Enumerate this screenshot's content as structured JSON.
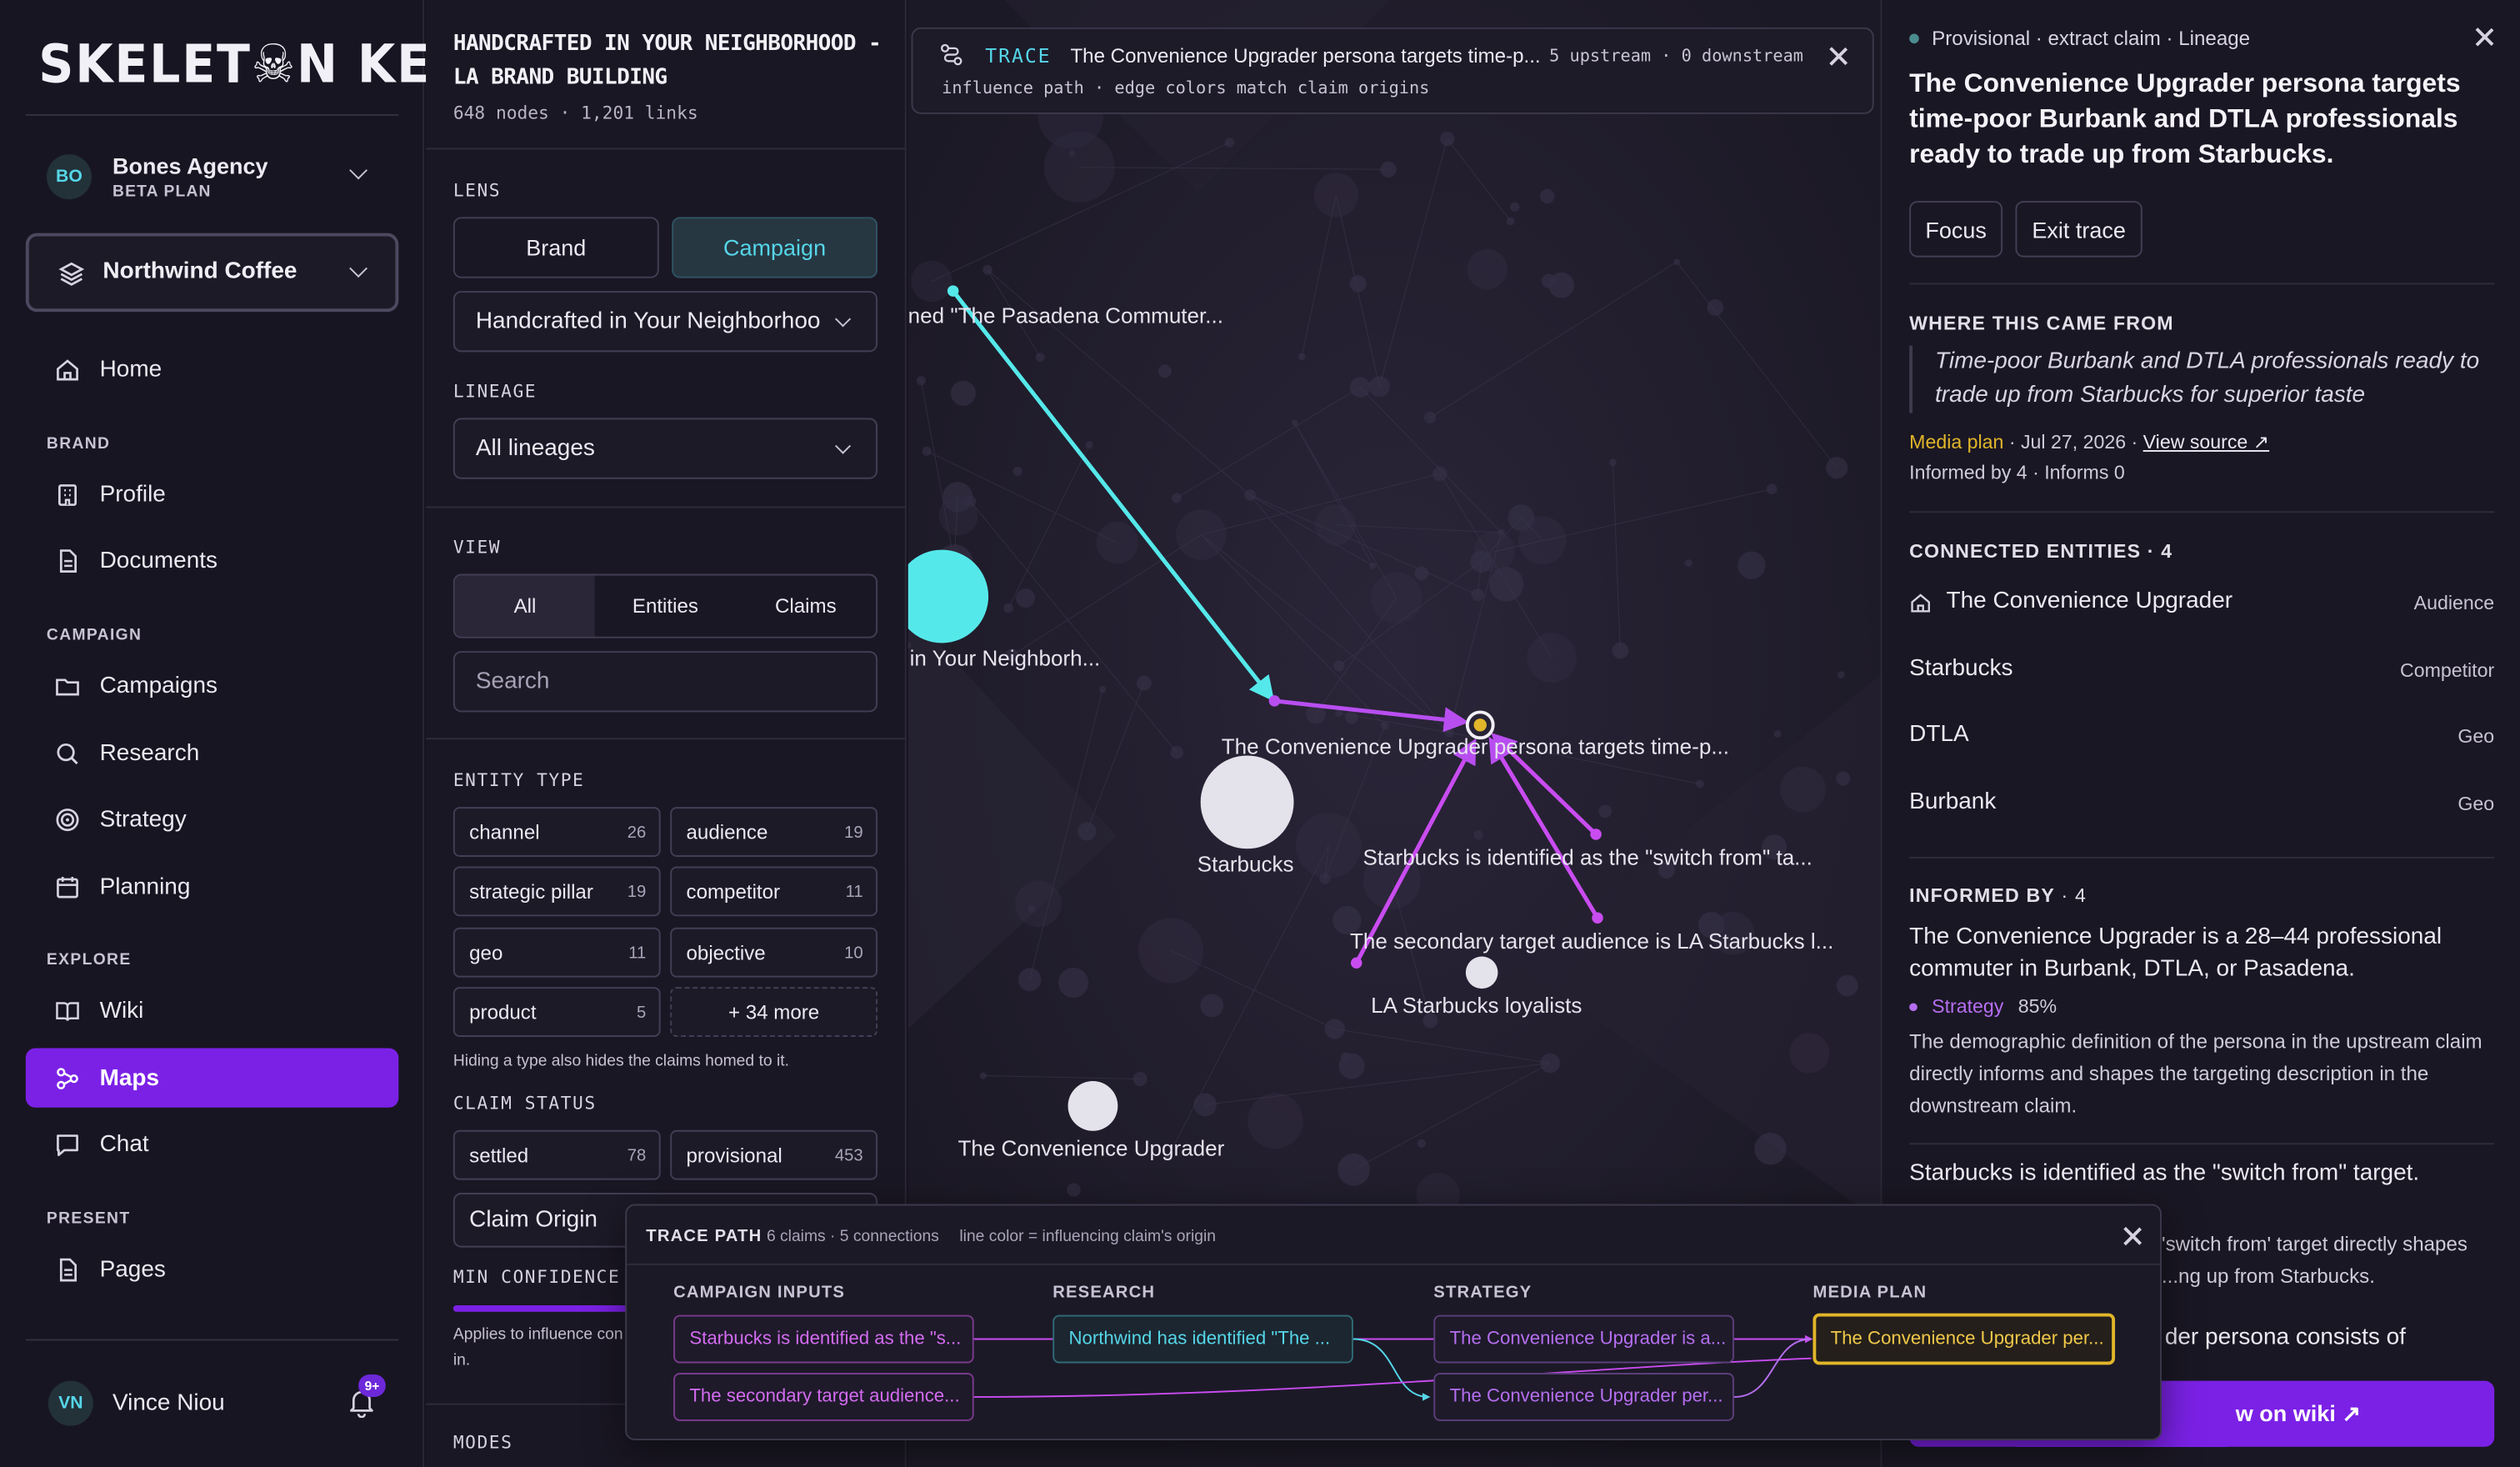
{
  "sidebar": {
    "logo": "SKELET☠N KEY",
    "agency": {
      "initials": "BO",
      "name": "Bones Agency",
      "plan": "BETA PLAN"
    },
    "project": "Northwind Coffee",
    "sections": {
      "brand": "BRAND",
      "campaign": "CAMPAIGN",
      "explore": "EXPLORE",
      "present": "PRESENT"
    },
    "nav": {
      "home": "Home",
      "profile": "Profile",
      "documents": "Documents",
      "campaigns": "Campaigns",
      "research": "Research",
      "strategy": "Strategy",
      "planning": "Planning",
      "wiki": "Wiki",
      "maps": "Maps",
      "chat": "Chat",
      "pages": "Pages"
    },
    "user": {
      "initials": "VN",
      "name": "Vince Niou",
      "notifications": "9+"
    }
  },
  "panel": {
    "title": "HANDCRAFTED IN YOUR NEIGHBORHOOD - LA BRAND BUILDING",
    "stats": "648 nodes · 1,201 links",
    "lens_label": "LENS",
    "lens_brand": "Brand",
    "lens_campaign": "Campaign",
    "campaign_select": "Handcrafted in Your Neighborhood",
    "lineage_label": "LINEAGE",
    "lineage_select": "All lineages",
    "view_label": "VIEW",
    "view_all": "All",
    "view_entities": "Entities",
    "view_claims": "Claims",
    "search_placeholder": "Search",
    "entity_type_label": "ENTITY TYPE",
    "entity_types": [
      {
        "name": "channel",
        "count": "26"
      },
      {
        "name": "audience",
        "count": "19"
      },
      {
        "name": "strategic pillar",
        "count": "19"
      },
      {
        "name": "competitor",
        "count": "11"
      },
      {
        "name": "geo",
        "count": "11"
      },
      {
        "name": "objective",
        "count": "10"
      },
      {
        "name": "product",
        "count": "5"
      }
    ],
    "more_types": "+ 34 more",
    "hiding_hint": "Hiding a type also hides the claims homed to it.",
    "claim_status_label": "CLAIM STATUS",
    "claim_status": [
      {
        "name": "settled",
        "count": "78"
      },
      {
        "name": "provisional",
        "count": "453"
      }
    ],
    "claim_origin": "Claim Origin",
    "min_conf_label": "MIN CONFIDENCE",
    "min_confidence": 0.35,
    "applies_hint_1": "Applies to influence con",
    "applies_hint_2": "in.",
    "modes_label": "MODES"
  },
  "map": {
    "trace_tag": "TRACE",
    "trace_text": "The Convenience Upgrader persona targets time-p...",
    "trace_counts": "5 upstream · 0 downstream",
    "trace_sub": "influence path · edge colors match claim origins",
    "labels": {
      "pasadena": "ned \"The Pasadena Commuter...",
      "neighborhood": "in Your Neighborh...",
      "cu_claim": "The Convenience Upgrader persona targets time-p...",
      "starbucks": "Starbucks",
      "switch_from": "Starbucks is identified as the \"switch from\" ta...",
      "secondary": "The secondary target audience is LA Starbucks l...",
      "loyalists": "LA Starbucks loyalists",
      "cu_entity": "The Convenience Upgrader"
    }
  },
  "detail": {
    "crumb": "Provisional · extract claim · Lineage",
    "title": "The Convenience Upgrader persona targets time-poor Burbank and DTLA professionals ready to trade up from Starbucks.",
    "focus": "Focus",
    "exit_trace": "Exit trace",
    "where_label": "WHERE THIS CAME FROM",
    "quote": "Time-poor Burbank and DTLA professionals ready to trade up from Starbucks for superior taste",
    "source_type": "Media plan",
    "source_date": " · Jul 27, 2026 · ",
    "view_source": "View source ↗",
    "informed_counts": "Informed by 4 · Informs 0",
    "connected_label": "CONNECTED ENTITIES · 4",
    "entities": [
      {
        "name": "The Convenience Upgrader",
        "type": "Audience"
      },
      {
        "name": "Starbucks",
        "type": "Competitor"
      },
      {
        "name": "DTLA",
        "type": "Geo"
      },
      {
        "name": "Burbank",
        "type": "Geo"
      }
    ],
    "informed_label": "INFORMED BY",
    "informed_count": " · 4",
    "informed": [
      {
        "title": "The Convenience Upgrader is a 28–44 professional commuter in Burbank, DTLA, or Pasadena.",
        "origin": "Strategy",
        "confidence": "85%",
        "text": "The demographic definition of the persona in the upstream claim directly informs and shapes the targeting description in the downstream claim."
      },
      {
        "title": "Starbucks is identified as the \"switch from\" target.",
        "text": "'switch from' target directly shapes ...ng up from Starbucks."
      }
    ],
    "partial_text": "der persona consists of",
    "wiki_button": "w on wiki ↗"
  },
  "trace_path": {
    "title": "TRACE PATH",
    "claims": "6 claims · 5 connections",
    "legend": "line color = influencing claim's origin",
    "columns": [
      "CAMPAIGN INPUTS",
      "RESEARCH",
      "STRATEGY",
      "MEDIA PLAN"
    ],
    "nodes": {
      "ci1": "Starbucks is identified as the \"s...",
      "ci2": "The secondary target audience...",
      "r1": "Northwind has identified \"The ...",
      "s1": "The Convenience Upgrader is a...",
      "s2": "The Convenience Upgrader per...",
      "m1": "The Convenience Upgrader per..."
    }
  },
  "colors": {
    "accent": "#7b21e6",
    "cyan": "#55d6e8",
    "magenta": "#c94cf0",
    "gold": "#e1b62a"
  }
}
